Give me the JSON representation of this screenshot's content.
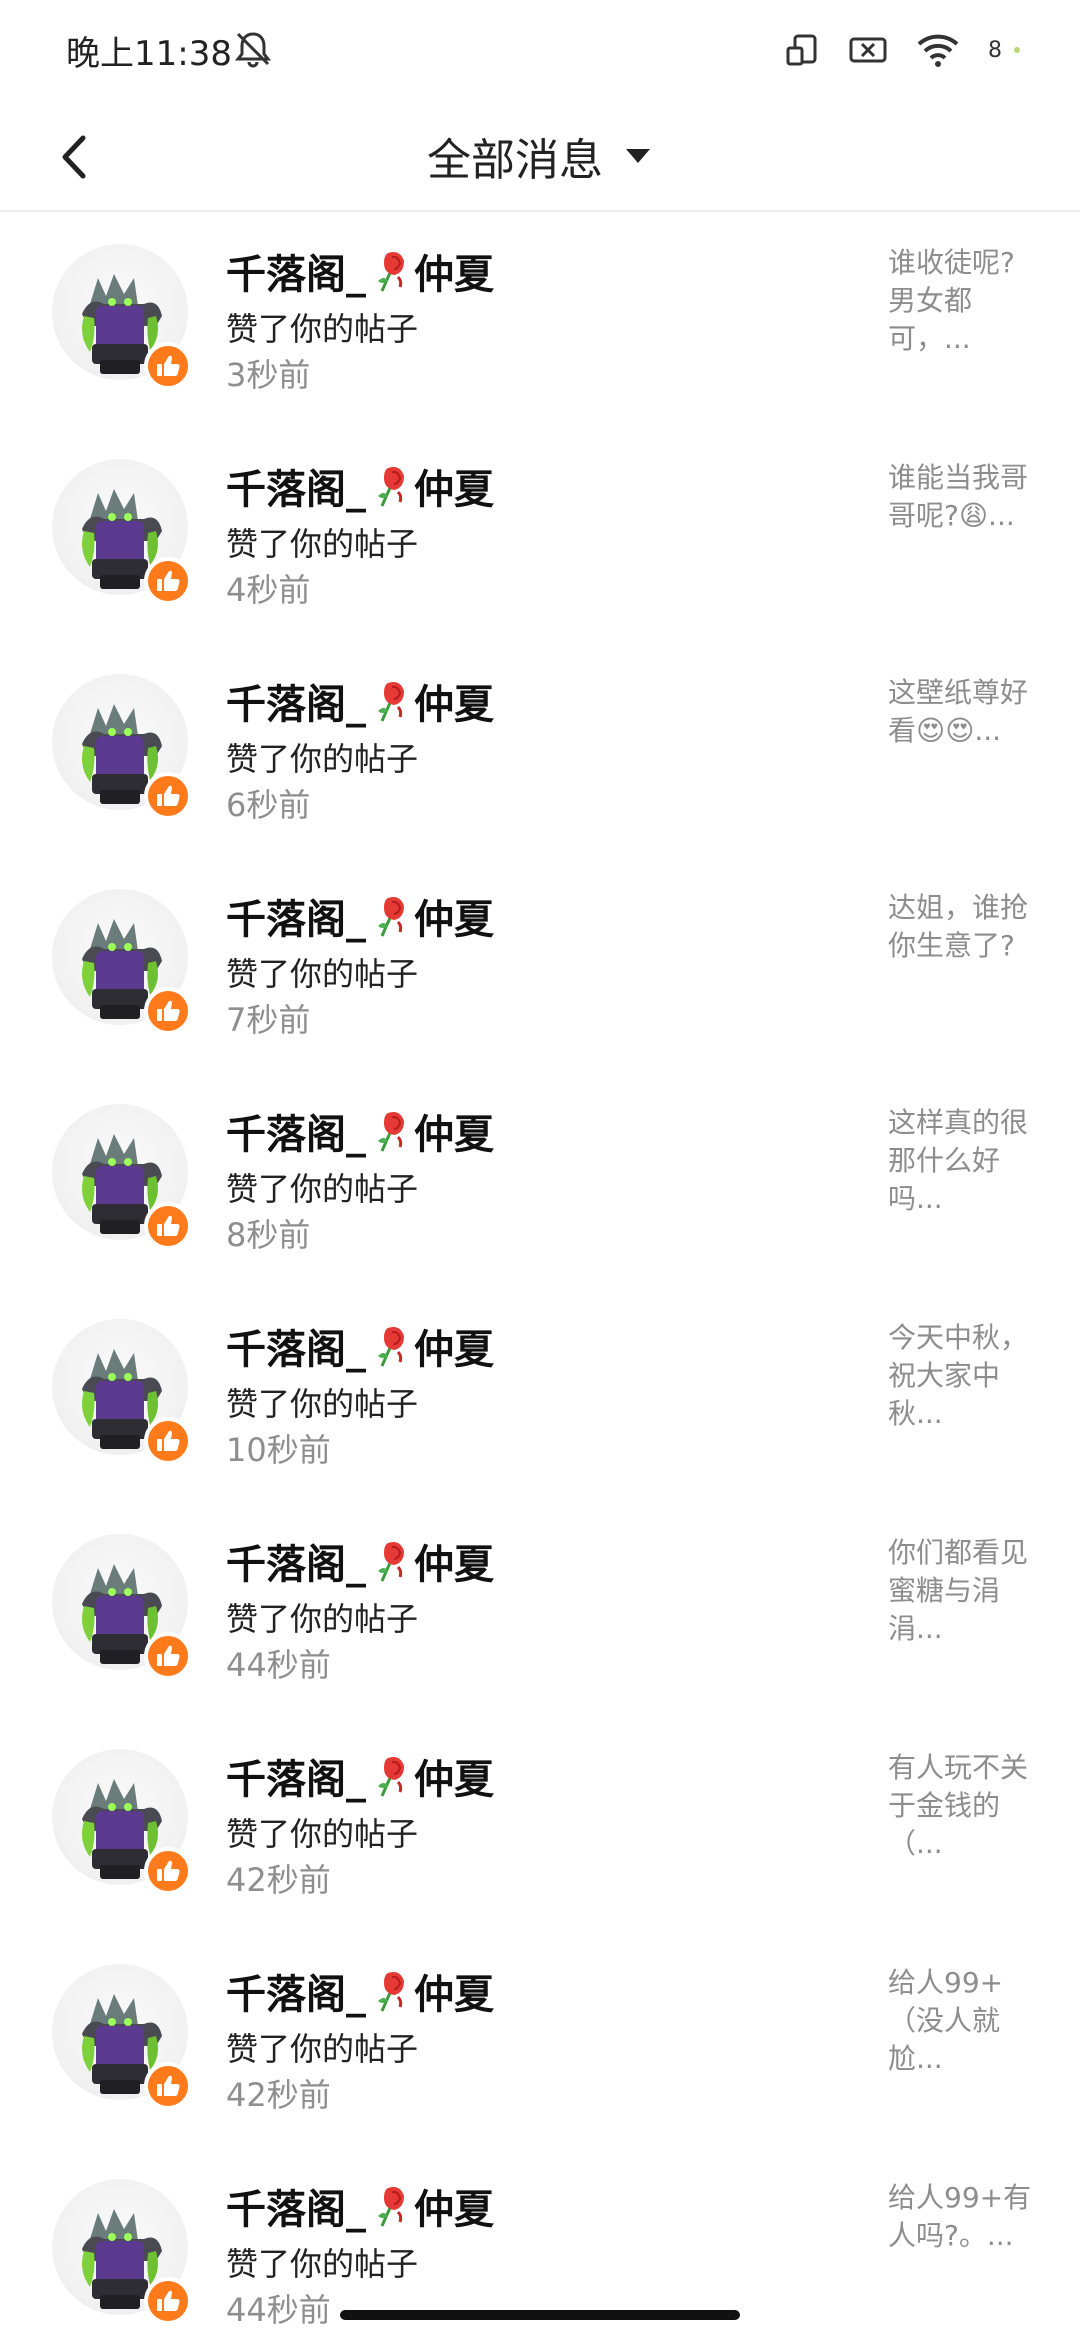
{
  "status_bar": {
    "time": "晚上11:38",
    "battery": "8",
    "icons": [
      "mute-icon",
      "rotate-icon",
      "sim-off-icon",
      "wifi-icon",
      "battery-icon"
    ]
  },
  "header": {
    "title": "全部消息",
    "back_icon": "chevron-left-icon",
    "dropdown_icon": "caret-down-icon"
  },
  "colors": {
    "accent": "#ff7a1a",
    "muted": "#8d8d8d",
    "text": "#111111"
  },
  "notifications": [
    {
      "name_prefix": "千落阁_",
      "name_suffix": "仲夏",
      "action": "赞了你的帖子",
      "time": "3秒前",
      "preview": "谁收徒呢?男女都可，..."
    },
    {
      "name_prefix": "千落阁_",
      "name_suffix": "仲夏",
      "action": "赞了你的帖子",
      "time": "4秒前",
      "preview": "谁能当我哥哥呢?😩..."
    },
    {
      "name_prefix": "千落阁_",
      "name_suffix": "仲夏",
      "action": "赞了你的帖子",
      "time": "6秒前",
      "preview": "这壁纸尊好看😍😍..."
    },
    {
      "name_prefix": "千落阁_",
      "name_suffix": "仲夏",
      "action": "赞了你的帖子",
      "time": "7秒前",
      "preview": "达姐，谁抢你生意了?"
    },
    {
      "name_prefix": "千落阁_",
      "name_suffix": "仲夏",
      "action": "赞了你的帖子",
      "time": "8秒前",
      "preview": "这样真的很那什么好吗..."
    },
    {
      "name_prefix": "千落阁_",
      "name_suffix": "仲夏",
      "action": "赞了你的帖子",
      "time": "10秒前",
      "preview": "今天中秋，祝大家中秋..."
    },
    {
      "name_prefix": "千落阁_",
      "name_suffix": "仲夏",
      "action": "赞了你的帖子",
      "time": "44秒前",
      "preview": "你们都看见蜜糖与涓涓..."
    },
    {
      "name_prefix": "千落阁_",
      "name_suffix": "仲夏",
      "action": "赞了你的帖子",
      "time": "42秒前",
      "preview": "有人玩不关于金钱的（..."
    },
    {
      "name_prefix": "千落阁_",
      "name_suffix": "仲夏",
      "action": "赞了你的帖子",
      "time": "42秒前",
      "preview": "给人99+（没人就尬..."
    },
    {
      "name_prefix": "千落阁_",
      "name_suffix": "仲夏",
      "action": "赞了你的帖子",
      "time": "44秒前",
      "preview": "给人99+有人吗?。..."
    }
  ]
}
